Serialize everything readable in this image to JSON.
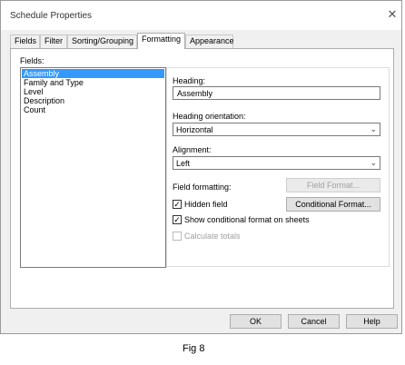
{
  "window": {
    "title": "Schedule Properties"
  },
  "tabs": [
    "Fields",
    "Filter",
    "Sorting/Grouping",
    "Formatting",
    "Appearance"
  ],
  "active_tab": "Formatting",
  "fields": {
    "label": "Fields:",
    "items": [
      "Assembly",
      "Family and Type",
      "Level",
      "Description",
      "Count"
    ],
    "selected": "Assembly"
  },
  "heading": {
    "label": "Heading:",
    "value": "Assembly"
  },
  "heading_orientation": {
    "label": "Heading orientation:",
    "value": "Horizontal"
  },
  "alignment": {
    "label": "Alignment:",
    "value": "Left"
  },
  "field_formatting": {
    "label": "Field formatting:",
    "button": "Field Format..."
  },
  "hidden_field": {
    "label": "Hidden field",
    "checked": true
  },
  "conditional_format_button": "Conditional Format...",
  "show_conditional": {
    "label": "Show conditional format on sheets",
    "checked": true
  },
  "calculate_totals": {
    "label": "Calculate totals",
    "checked": false
  },
  "footer": {
    "ok": "OK",
    "cancel": "Cancel",
    "help": "Help"
  },
  "caption": "Fig 8"
}
